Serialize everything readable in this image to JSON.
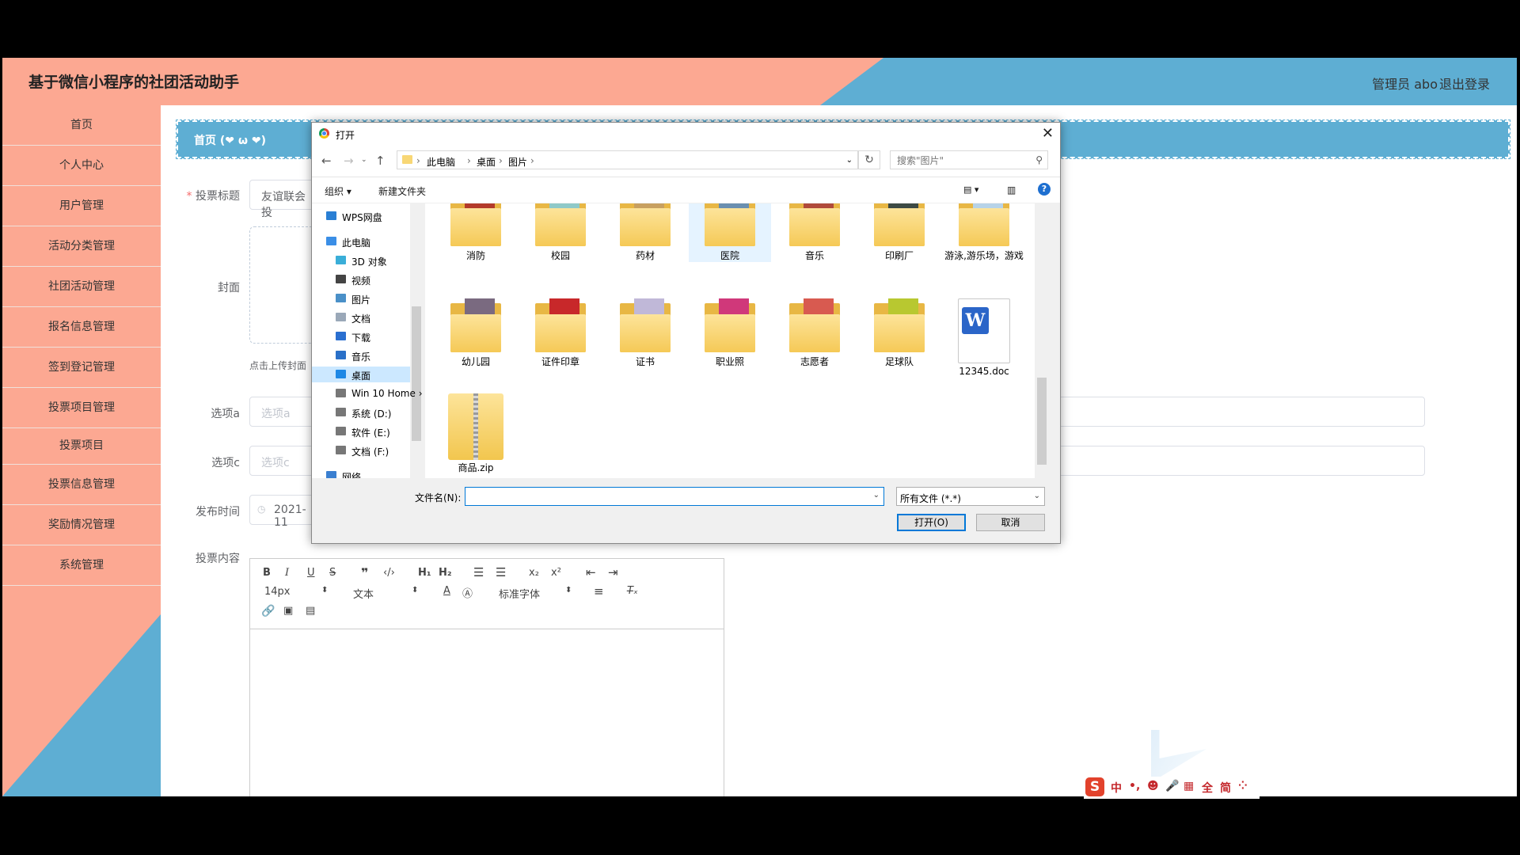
{
  "header": {
    "title": "基于微信小程序的社团活动助手",
    "user": "管理员 abo",
    "logout": "退出登录"
  },
  "sidebar": {
    "items": [
      "首页",
      "个人中心",
      "用户管理",
      "活动分类管理",
      "社团活动管理",
      "报名信息管理",
      "签到登记管理",
      "投票项目管理",
      "投票项目",
      "投票信息管理",
      "奖励情况管理",
      "系统管理"
    ]
  },
  "breadcrumb": {
    "text": "首页  (❤ ω ❤)"
  },
  "form": {
    "title_label": "投票标题",
    "title_required": "*",
    "title_value": "友谊联会投",
    "cover_label": "封面",
    "cover_tip": "点击上传封面",
    "option_a_label": "选项a",
    "option_a_placeholder": "选项a",
    "option_c_label": "选项c",
    "option_c_placeholder": "选项c",
    "publish_label": "发布时间",
    "publish_value": "2021-11",
    "content_label": "投票内容"
  },
  "editor": {
    "font_size": "14px",
    "text_type": "文本",
    "font_family": "标准字体"
  },
  "dialog": {
    "title": "打开",
    "path": [
      "此电脑",
      "桌面",
      "图片"
    ],
    "search_placeholder": "搜索\"图片\"",
    "organize": "组织 ▾",
    "new_folder": "新建文件夹",
    "nav_items": [
      {
        "label": "WPS网盘",
        "icon": "cloud-icon"
      },
      {
        "label": "此电脑",
        "icon": "computer-icon"
      },
      {
        "label": "3D 对象",
        "icon": "cube-icon"
      },
      {
        "label": "视频",
        "icon": "video-icon"
      },
      {
        "label": "图片",
        "icon": "picture-icon"
      },
      {
        "label": "文档",
        "icon": "document-icon"
      },
      {
        "label": "下载",
        "icon": "download-icon"
      },
      {
        "label": "音乐",
        "icon": "music-icon"
      },
      {
        "label": "桌面",
        "icon": "desktop-icon"
      },
      {
        "label": "Win 10 Home ›",
        "icon": "drive-icon"
      },
      {
        "label": "系统 (D:)",
        "icon": "drive-icon"
      },
      {
        "label": "软件 (E:)",
        "icon": "drive-icon"
      },
      {
        "label": "文档 (F:)",
        "icon": "drive-icon"
      },
      {
        "label": "网络",
        "icon": "network-icon"
      }
    ],
    "files": [
      {
        "name": "消防",
        "type": "folder",
        "color": "#b33a2a"
      },
      {
        "name": "校园",
        "type": "folder",
        "color": "#8fc9c8"
      },
      {
        "name": "药材",
        "type": "folder",
        "color": "#c8a060"
      },
      {
        "name": "医院",
        "type": "folder",
        "color": "#6a8fb0"
      },
      {
        "name": "音乐",
        "type": "folder",
        "color": "#b04a3a"
      },
      {
        "name": "印刷厂",
        "type": "folder",
        "color": "#3d4a44"
      },
      {
        "name": "游泳,游乐场，游戏",
        "type": "folder",
        "color": "#b7d3e8"
      },
      {
        "name": "幼儿园",
        "type": "folder",
        "color": "#7a6a80"
      },
      {
        "name": "证件印章",
        "type": "folder",
        "color": "#c8282a"
      },
      {
        "name": "证书",
        "type": "folder",
        "color": "#c0b8d8"
      },
      {
        "name": "职业照",
        "type": "folder",
        "color": "#d0387a"
      },
      {
        "name": "志愿者",
        "type": "folder",
        "color": "#d85a50"
      },
      {
        "name": "足球队",
        "type": "folder",
        "color": "#b8c830"
      },
      {
        "name": "12345.doc",
        "type": "doc",
        "color": "#2b65c8"
      },
      {
        "name": "商品.zip",
        "type": "zip",
        "color": "#f2c64e"
      }
    ],
    "filename_label": "文件名(N):",
    "filename_value": "",
    "filetype": "所有文件 (*.*)",
    "open_btn": "打开(O)",
    "cancel_btn": "取消"
  },
  "ime": {
    "logo": "S",
    "items": [
      "中",
      "•,",
      "☻",
      "🎤",
      "▦",
      "全",
      "简",
      "⁘"
    ]
  }
}
